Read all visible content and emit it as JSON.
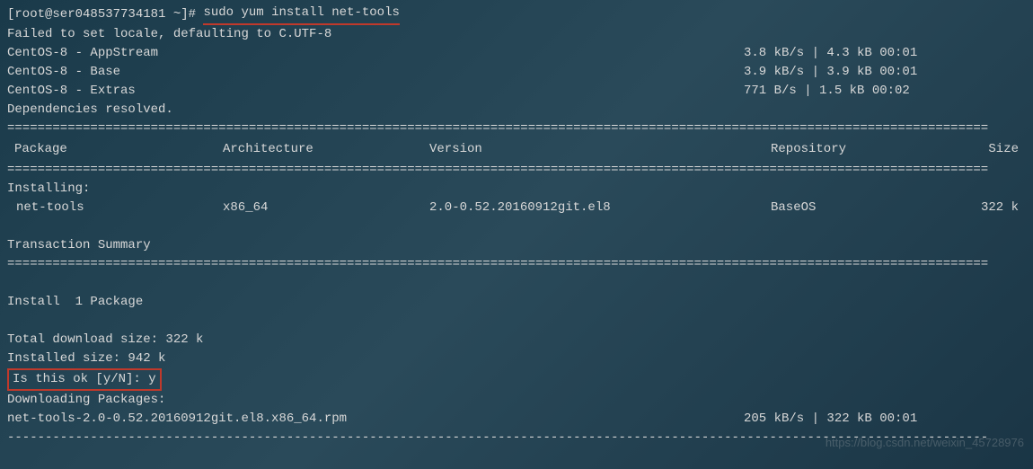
{
  "prompt": {
    "user_host": "[root@ser048537734181 ~]#",
    "command": "sudo yum install net-tools"
  },
  "locale_msg": "Failed to set locale, defaulting to C.UTF-8",
  "repos": [
    {
      "name": "CentOS-8 - AppStream",
      "stats": "3.8 kB/s | 4.3 kB     00:01"
    },
    {
      "name": "CentOS-8 - Base",
      "stats": "3.9 kB/s | 3.9 kB     00:01"
    },
    {
      "name": "CentOS-8 - Extras",
      "stats": "771  B/s | 1.5 kB     00:02"
    }
  ],
  "deps_resolved": "Dependencies resolved.",
  "divider": "==================================================================================================================================",
  "dash_divider": "----------------------------------------------------------------------------------------------------------------------------------",
  "headers": {
    "package": "Package",
    "arch": "Architecture",
    "version": "Version",
    "repo": "Repository",
    "size": "Size"
  },
  "installing_label": "Installing:",
  "package": {
    "name": "net-tools",
    "arch": "x86_64",
    "version": "2.0-0.52.20160912git.el8",
    "repo": "BaseOS",
    "size": "322 k"
  },
  "trans_summary": "Transaction Summary",
  "install_count": "Install  1 Package",
  "total_dl": "Total download size: 322 k",
  "installed_size": "Installed size: 942 k",
  "confirm": "Is this ok [y/N]: y",
  "downloading": "Downloading Packages:",
  "download": {
    "name": "net-tools-2.0-0.52.20160912git.el8.x86_64.rpm",
    "stats": "205 kB/s | 322 kB     00:01"
  },
  "watermark": "https://blog.csdn.net/weixin_45728976"
}
